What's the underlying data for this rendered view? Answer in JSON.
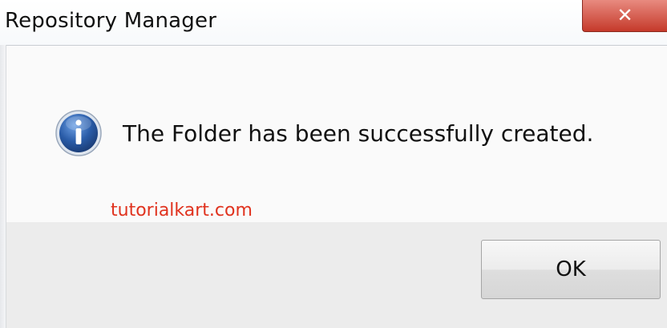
{
  "window": {
    "title": "Repository Manager",
    "close_glyph": "✕"
  },
  "dialog": {
    "icon": "info-icon",
    "message": "The Folder has been successfully created.",
    "watermark": "tutorialkart.com",
    "ok_label": "OK"
  },
  "colors": {
    "close_button": "#c53a2b",
    "watermark": "#e0321e",
    "info_icon": "#2a5ca8"
  }
}
